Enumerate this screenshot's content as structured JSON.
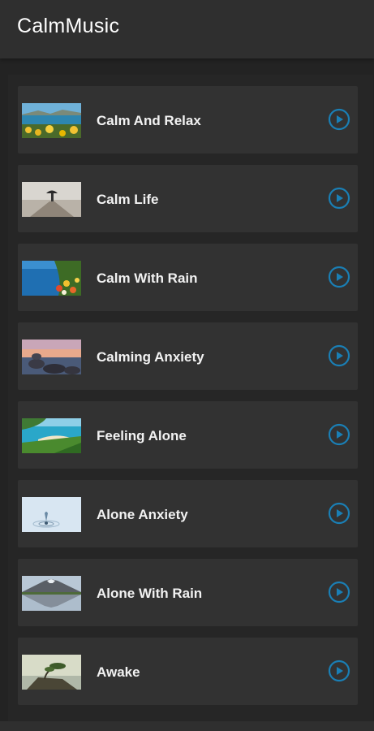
{
  "app": {
    "title": "CalmMusic"
  },
  "colors": {
    "accent": "#1a7fb5",
    "card": "#323232",
    "appbar": "#2f2f2f"
  },
  "tracks": [
    {
      "title": "Calm And Relax",
      "thumbnail": "coast-flowers-image",
      "play_icon": "play-circle-icon"
    },
    {
      "title": "Calm Life",
      "thumbnail": "person-umbrella-image",
      "play_icon": "play-circle-icon"
    },
    {
      "title": "Calm With Rain",
      "thumbnail": "lake-flowers-image",
      "play_icon": "play-circle-icon"
    },
    {
      "title": "Calming Anxiety",
      "thumbnail": "stones-sunset-image",
      "play_icon": "play-circle-icon"
    },
    {
      "title": "Feeling Alone",
      "thumbnail": "beach-cove-image",
      "play_icon": "play-circle-icon"
    },
    {
      "title": "Alone Anxiety",
      "thumbnail": "water-drop-image",
      "play_icon": "play-circle-icon"
    },
    {
      "title": "Alone With Rain",
      "thumbnail": "volcano-reflection-image",
      "play_icon": "play-circle-icon"
    },
    {
      "title": "Awake",
      "thumbnail": "tree-rock-image",
      "play_icon": "play-circle-icon"
    }
  ]
}
